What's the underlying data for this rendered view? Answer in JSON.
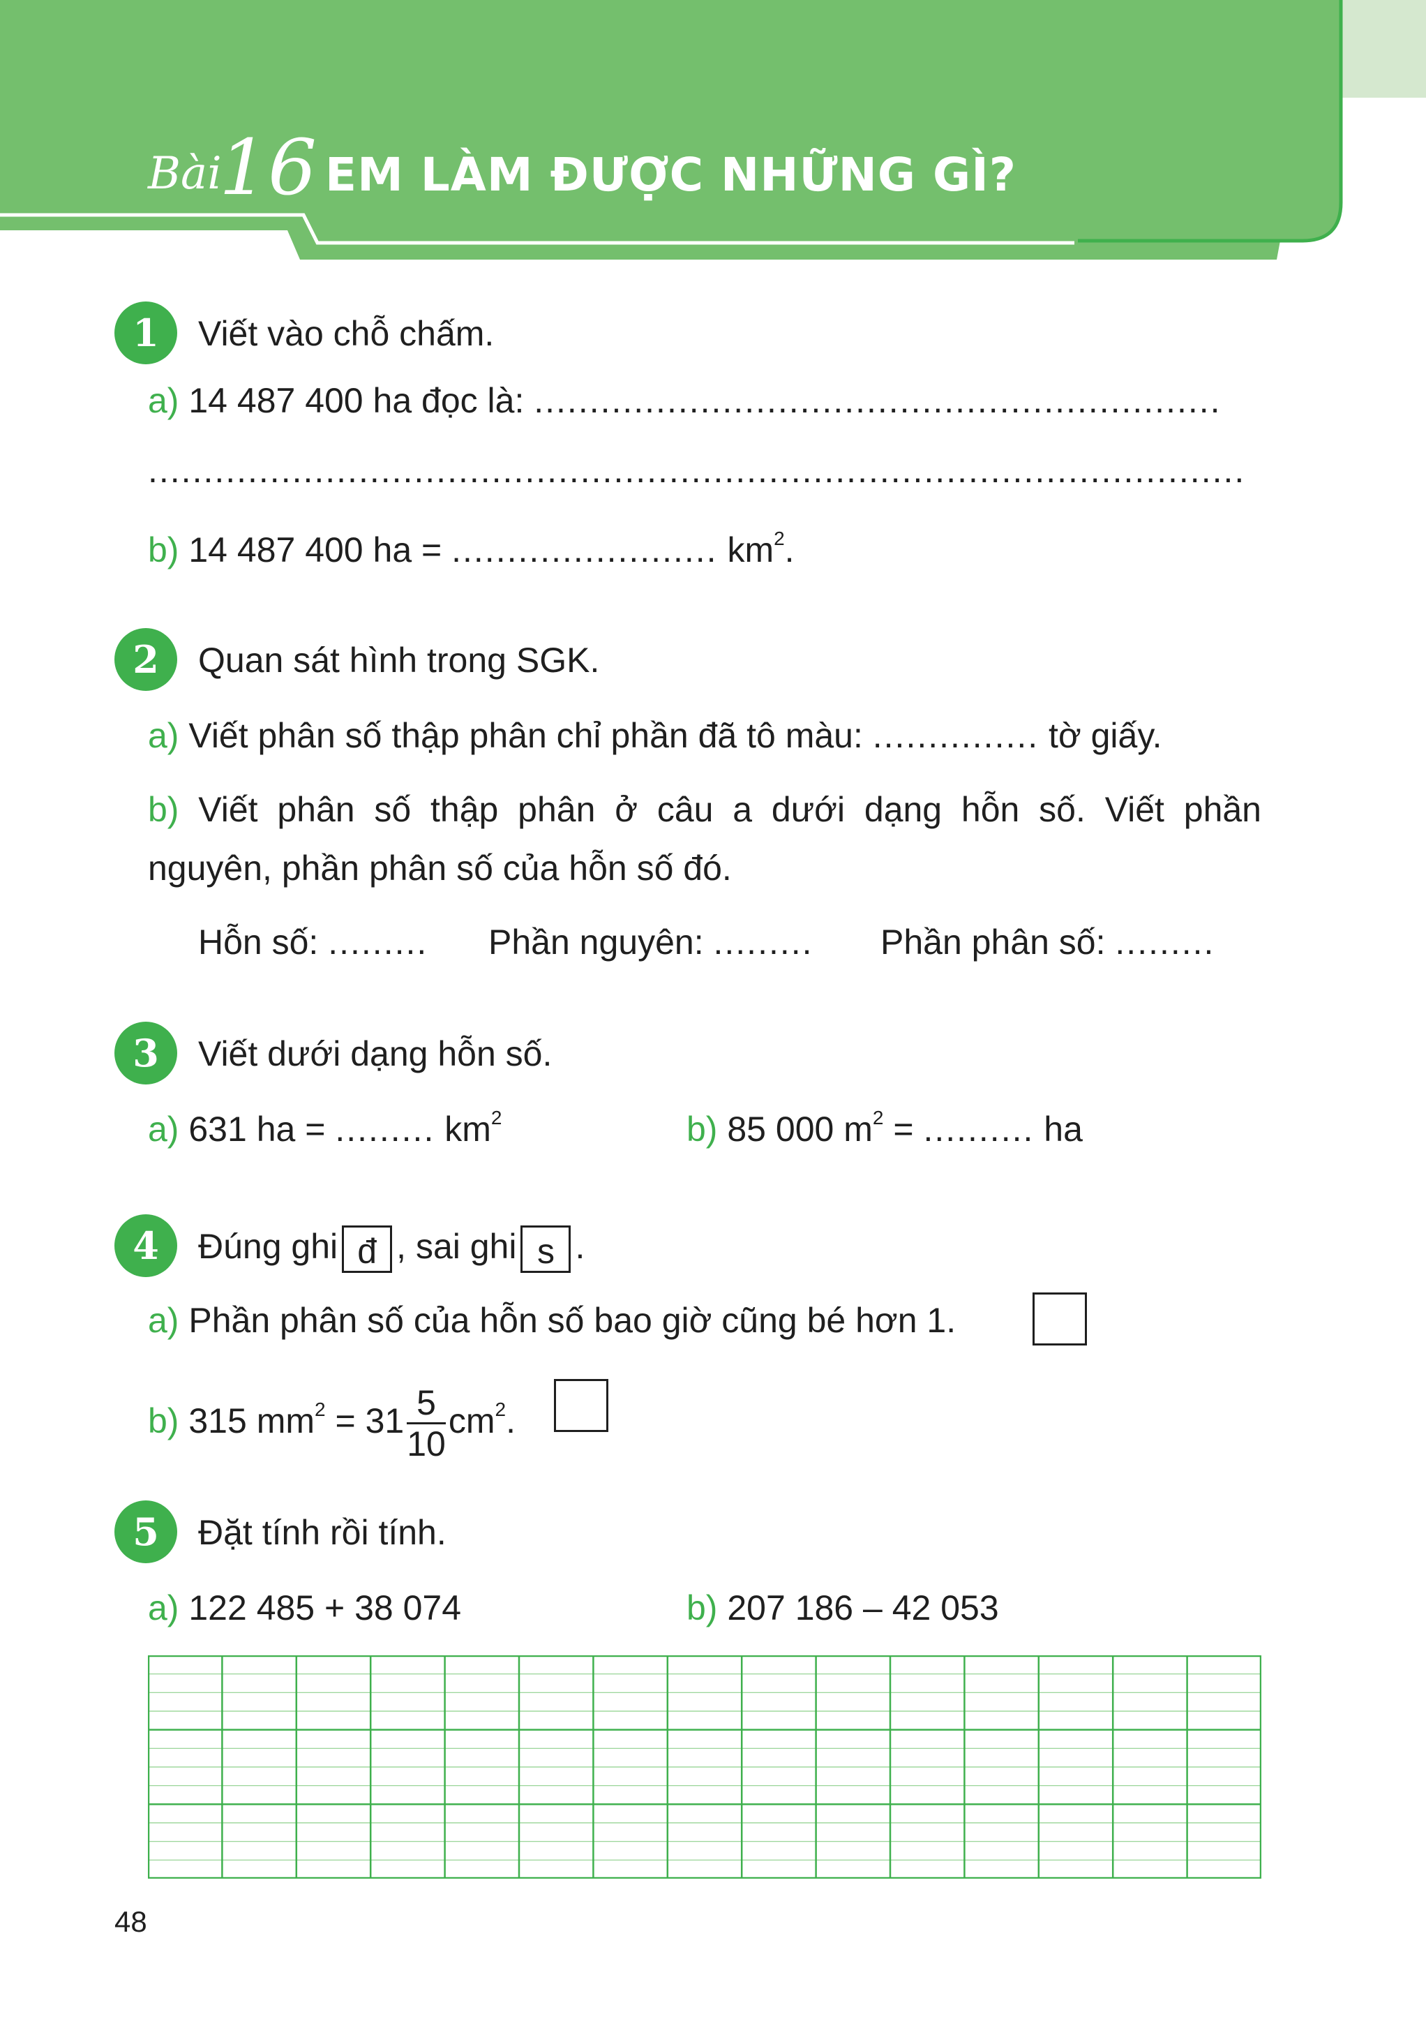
{
  "colors": {
    "banner": "#74bf6d",
    "accent": "#3fb04d",
    "pale": "#d5e8cf",
    "grid_light": "#8ed08b",
    "grid_dark": "#3fb04d"
  },
  "header": {
    "bai_label": "Bài",
    "bai_number": "16",
    "title": "EM LÀM ĐƯỢC NHỮNG GÌ?"
  },
  "exercises": {
    "ex1": {
      "number": "1",
      "prompt": "Viết vào chỗ chấm.",
      "a_label": "a)",
      "a_text": "14 487 400 ha đọc là:",
      "dots_long": "..............................................................",
      "dots_full": "...................................................................................................",
      "b_label": "b)",
      "b_text": "14 487 400 ha =",
      "b_dots": "........................",
      "b_unit": "km",
      "b_sup": "2",
      "b_end": "."
    },
    "ex2": {
      "number": "2",
      "prompt": "Quan sát hình trong SGK.",
      "a_label": "a)",
      "a_text": "Viết phân số thập phân chỉ phần đã tô màu:",
      "a_dots": "...............",
      "a_end": "tờ giấy.",
      "b_label": "b)",
      "b_line1": "Viết phân số thập phân ở câu a dưới dạng hỗn số. Viết phần",
      "b_line2": "nguyên, phần phân số của hỗn số đó.",
      "mixed": "Hỗn số:",
      "whole": "Phần nguyên:",
      "fraction_part": "Phần phân số:",
      "short_dots": "........."
    },
    "ex3": {
      "number": "3",
      "prompt": "Viết dưới dạng hỗn số.",
      "a_label": "a)",
      "a_text": "631 ha =",
      "a_dots": ".........",
      "a_unit": "km",
      "a_sup": "2",
      "b_label": "b)",
      "b_text": "85 000 m",
      "b_sup": "2",
      "b_eq": "=",
      "b_dots": "..........",
      "b_unit": "ha"
    },
    "ex4": {
      "number": "4",
      "prompt_start": "Đúng ghi",
      "true_mark": "đ",
      "prompt_mid": ", sai ghi",
      "false_mark": "s",
      "prompt_end": ".",
      "a_label": "a)",
      "a_text": "Phần phân số của hỗn số bao giờ cũng bé hơn 1.",
      "b_label": "b)",
      "b_text": "315 mm",
      "b_sup": "2",
      "b_eq": "= 31",
      "frac_num": "5",
      "frac_den": "10",
      "b_unit": "cm",
      "b_sup2": "2",
      "b_end": "."
    },
    "ex5": {
      "number": "5",
      "prompt": "Đặt tính rồi tính.",
      "a_label": "a)",
      "a_text": "122 485 + 38 074",
      "b_label": "b)",
      "b_text": "207 186 – 42 053"
    }
  },
  "page_number": "48"
}
